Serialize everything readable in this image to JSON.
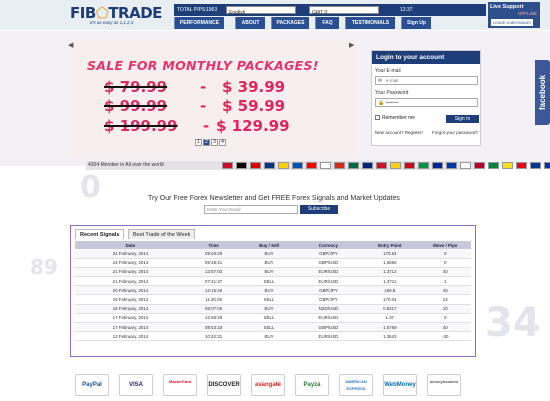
{
  "brand": {
    "logo_prefix": "FIB",
    "logo_suffix": "TRADE",
    "tagline": "It's as easy as 1,1,2,3"
  },
  "topbar": {
    "total_pips_label": "TOTAL PIPS:",
    "total_pips_value": "1963",
    "language": "English",
    "timezone": "GMT 0",
    "time": "12:37"
  },
  "nav": [
    "PERFORMANCE",
    "ABOUT",
    "PACKAGES",
    "FAQ",
    "TESTIMONIALS",
    "Sign Up"
  ],
  "live_support": {
    "title": "Live Support",
    "status": "OFFLINE",
    "leave_message": "LEAVE A MESSAGE!"
  },
  "promo": {
    "heading": "SALE FOR MONTHLY PACKAGES!",
    "rows": [
      {
        "old": "$ 79.99",
        "new": "$ 39.99"
      },
      {
        "old": "$ 99.99",
        "new": "$ 59.99"
      },
      {
        "old": "$ 199.99",
        "new": "$ 129.99"
      }
    ],
    "pages": [
      "1",
      "2",
      "3",
      "4"
    ],
    "current_page": "2"
  },
  "members": "4204 Member in All over the world",
  "flag_colors": [
    "#c8102e",
    "#000",
    "#dd0000",
    "#003580",
    "#ffce00",
    "#0052b4",
    "#ff0000",
    "#fff",
    "#d52b1e",
    "#006847",
    "#00247d",
    "#ce1126",
    "#fcd116",
    "#c60b1e",
    "#009246",
    "#002395",
    "#0038a8",
    "#ffffff",
    "#bc002d",
    "#00843d",
    "#f7e017",
    "#e30a17",
    "#003893",
    "#0033a0"
  ],
  "login": {
    "title": "Login to your account",
    "email_label": "Your E-mail",
    "email_placeholder": "e-mail",
    "password_label": "Your Password",
    "password_placeholder": "••••••••",
    "remember": "Remember me",
    "signin": "Sign In",
    "new_account": "New account? Register!",
    "forgot": "Forgot your password?"
  },
  "facebook_tab": "facebook",
  "newsletter": {
    "text": "Try Our Free Forex Newsletter and Get FREE Forex Signals and Market Updates",
    "placeholder": "Enter Your Email",
    "button": "Subscribe"
  },
  "signals": {
    "tabs": [
      "Recent Signals",
      "Best Trade of the Week"
    ],
    "columns": [
      "Date",
      "Time",
      "Buy / Sell",
      "Currency",
      "Entry Point",
      "Move / Pips"
    ],
    "rows": [
      [
        "24 February, 2014",
        "09:49:28",
        "BUY",
        "GBP/JPY",
        "170.64",
        "0"
      ],
      [
        "24 February, 2014",
        "09:48:41",
        "BUY",
        "GBP/USD",
        "1.6666",
        "0"
      ],
      [
        "21 February, 2014",
        "13:57:03",
        "BUY",
        "EUR/USD",
        "1.3712",
        "40"
      ],
      [
        "21 February, 2014",
        "07:41:37",
        "SELL",
        "EUR/USD",
        "1.3711",
        "1"
      ],
      [
        "20 February, 2014",
        "12:15:26",
        "BUY",
        "GBP/JPY",
        "169.8",
        "40"
      ],
      [
        "19 February, 2014",
        "11:30:29",
        "SELL",
        "GBP/JPY",
        "170.04",
        "14"
      ],
      [
        "18 February, 2014",
        "08:07:05",
        "BUY",
        "NZD/USD",
        "0.8317",
        "10"
      ],
      [
        "17 February, 2014",
        "12:55:29",
        "SELL",
        "EUR/USD",
        "1.37",
        "0"
      ],
      [
        "17 February, 2014",
        "08:53:18",
        "SELL",
        "GBP/USD",
        "1.6769",
        "40"
      ],
      [
        "12 February, 2014",
        "10:42:31",
        "BUY",
        "EUR/USD",
        "1.3643",
        "-30"
      ]
    ]
  },
  "payments": [
    {
      "label": "PayPal",
      "color": "#1d4f9c"
    },
    {
      "label": "VISA",
      "color": "#1a1f71"
    },
    {
      "label": "MasterCard",
      "color": "#eb001b"
    },
    {
      "label": "DISCOVER",
      "color": "#222"
    },
    {
      "label": "avangate",
      "color": "#e2231a"
    },
    {
      "label": "Payza",
      "color": "#2e7d32"
    },
    {
      "label": "AMERICAN EXPRESS",
      "color": "#2e77bb"
    },
    {
      "label": "WebMoney",
      "color": "#036cb5"
    },
    {
      "label": "moneybookers",
      "color": "#555"
    }
  ]
}
